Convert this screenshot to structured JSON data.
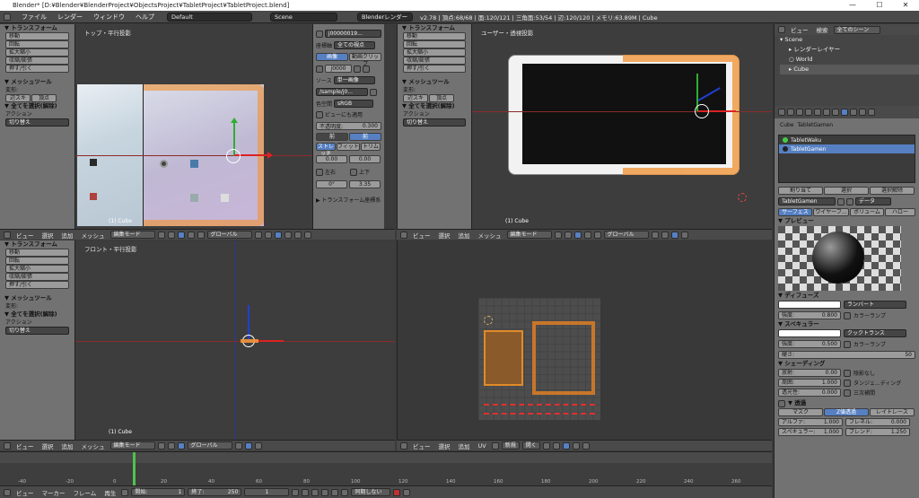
{
  "window": {
    "title": "Blender* [D:¥Blender¥BlenderProject¥ObjectsProject¥TabletProject¥TabletProject.blend]",
    "minimize": "—",
    "maximize": "☐",
    "close": "✕"
  },
  "topmenu": {
    "items": [
      "ファイル",
      "レンダー",
      "ウィンドウ",
      "ヘルプ"
    ],
    "layout": "Default",
    "scene": "Scene",
    "engine": "Blenderレンダー",
    "stats": "v2.78 | 頂点:68/68 | 面:120/121 | 三角面:53/54 | 辺:120/120 | メモリ:63.89M | Cube"
  },
  "toolshelf": {
    "transform": "▼ トランスフォーム",
    "move": "移動",
    "rotate": "回転",
    "scale": "拡大縮小",
    "shrink": "収縮/膨張",
    "push": "押す/引く",
    "meshtools": "▼ メッシュツール",
    "deform": "変形:",
    "slide_edge": "辺スキ",
    "slide_vertex": "頂点",
    "select_all": "▼ 全てを選択(解除)",
    "action": "アクション",
    "toggle": "切り替え"
  },
  "viewports": {
    "top_ortho": "トップ・平行投影",
    "user_persp": "ユーザー・透視投影",
    "front_ortho": "フロント・平行投影",
    "object_label": "(1) Cube"
  },
  "image_panel": {
    "image_name": "j00000019...",
    "source_label": "ソース",
    "single_image": "単一画像",
    "colorspace_label": "色空間",
    "colorspace": "sRGB",
    "view_as_render": "ビューにも適用",
    "opacity_label": "不透明度:",
    "opacity": "0.300",
    "front": "前",
    "back": "前",
    "stretch": "ストレッチ",
    "fit": "フィット",
    "crop": "トリム",
    "val1": "0.00",
    "val2": "0.00",
    "flipx": "左右",
    "flipy": "上下",
    "rot": "0°",
    "size": "3.35",
    "transform_axes": "▶ トランスフォーム座標系",
    "axis_label": "座標軸",
    "all_views": "全ての視点",
    "image_btn": "画像",
    "movie_btn": "動画クリップ",
    "file_num": "j0000",
    "file_path": "/sample/j0..."
  },
  "headers": {
    "view": "ビュー",
    "select": "選択",
    "add": "追加",
    "mesh": "メッシュ",
    "uv": "UV",
    "edit_mode": "編集モード",
    "global": "グローバル",
    "new": "新規",
    "open": "開く"
  },
  "timeline": {
    "view": "ビュー",
    "marker": "マーカー",
    "frame": "フレーム",
    "play": "再生",
    "start_label": "開始:",
    "start": "1",
    "end_label": "終了:",
    "end": "250",
    "current": "1",
    "sync": "同期しない",
    "ticks": [
      "-40",
      "-20",
      "0",
      "20",
      "40",
      "60",
      "80",
      "100",
      "120",
      "140",
      "160",
      "180",
      "200",
      "220",
      "240",
      "260"
    ]
  },
  "outliner": {
    "view": "ビュー",
    "search": "検索",
    "all_scenes": "全てのシーン",
    "scene": "Scene",
    "render_layers": "レンダーレイヤー",
    "world": "World",
    "cube": "Cube"
  },
  "properties": {
    "slot1": "TabletWaku",
    "slot2": "TabletGamen",
    "assign": "割り当て",
    "select": "選択",
    "deselect": "選択解除",
    "material": "TabletGamen",
    "data": "データ",
    "tab_surface": "サーフェス",
    "tab_wire": "ワイヤーフ...",
    "tab_volume": "ボリューム",
    "tab_halo": "ハロー",
    "preview": "▼ プレビュー",
    "diffuse": "▼ ディフューズ",
    "lambert": "ランバート",
    "intensity_label": "強度:",
    "diffuse_int": "0.800",
    "ramp": "カラーランプ",
    "specular": "▼ スペキュラー",
    "cooktorr": "クックトランス",
    "spec_int": "0.500",
    "hardness_label": "硬さ:",
    "hardness": "50",
    "shading": "▼ シェーディング",
    "emit_label": "放射:",
    "emit": "0.00",
    "ambient_label": "周囲:",
    "ambient": "1.000",
    "translucency_label": "透光性:",
    "translucency": "0.000",
    "shadeless": "陰影なし",
    "tangent": "タンジェ...ディング",
    "cubic": "三次補間",
    "transparency": "▼ 透過",
    "mask": "マスク",
    "ztransp": "Z値透過",
    "raytrace": "レイトレース",
    "alpha_label": "アルファ:",
    "alpha": "1.000",
    "fresnel_label": "フレネル:",
    "fresnel": "0.000",
    "specular_alpha_label": "スペキュラー:",
    "specular_alpha": "1.000",
    "blend_label": "ブレンド:",
    "blend": "1.250"
  }
}
